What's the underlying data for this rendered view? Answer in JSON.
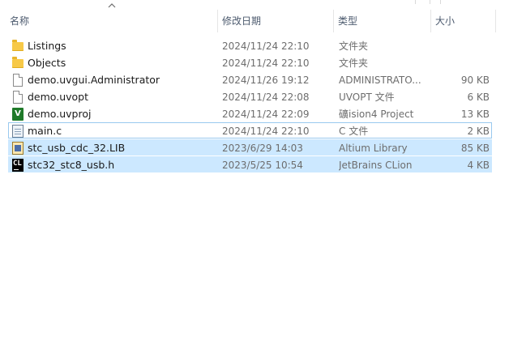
{
  "columns": {
    "name": "名称",
    "date": "修改日期",
    "type": "类型",
    "size": "大小"
  },
  "files": [
    {
      "name": "Listings",
      "date": "2024/11/24 22:10",
      "type": "文件夹",
      "size": "",
      "icon": "folder-icon"
    },
    {
      "name": "Objects",
      "date": "2024/11/24 22:10",
      "type": "文件夹",
      "size": "",
      "icon": "folder-icon"
    },
    {
      "name": "demo.uvgui.Administrator",
      "date": "2024/11/26 19:12",
      "type": "ADMINISTRATO...",
      "size": "90 KB",
      "icon": "document-icon"
    },
    {
      "name": "demo.uvopt",
      "date": "2024/11/24 22:08",
      "type": "UVOPT 文件",
      "size": "6 KB",
      "icon": "document-icon"
    },
    {
      "name": "demo.uvproj",
      "date": "2024/11/24 22:09",
      "type": "礦ision4 Project",
      "size": "13 KB",
      "icon": "keil-project-icon"
    },
    {
      "name": "main.c",
      "date": "2024/11/24 22:10",
      "type": "C 文件",
      "size": "2 KB",
      "icon": "c-file-icon"
    },
    {
      "name": "stc_usb_cdc_32.LIB",
      "date": "2023/6/29 14:03",
      "type": "Altium Library",
      "size": "85 KB",
      "icon": "library-icon"
    },
    {
      "name": "stc32_stc8_usb.h",
      "date": "2023/5/25 10:54",
      "type": "JetBrains CLion",
      "size": "4 KB",
      "icon": "clion-icon"
    }
  ],
  "icon_glyphs": {
    "keil": "V",
    "clion": "CL"
  },
  "colors": {
    "selection": "#cce8ff",
    "focus_border": "#99c9ef",
    "header_text": "#4c5a6e"
  }
}
